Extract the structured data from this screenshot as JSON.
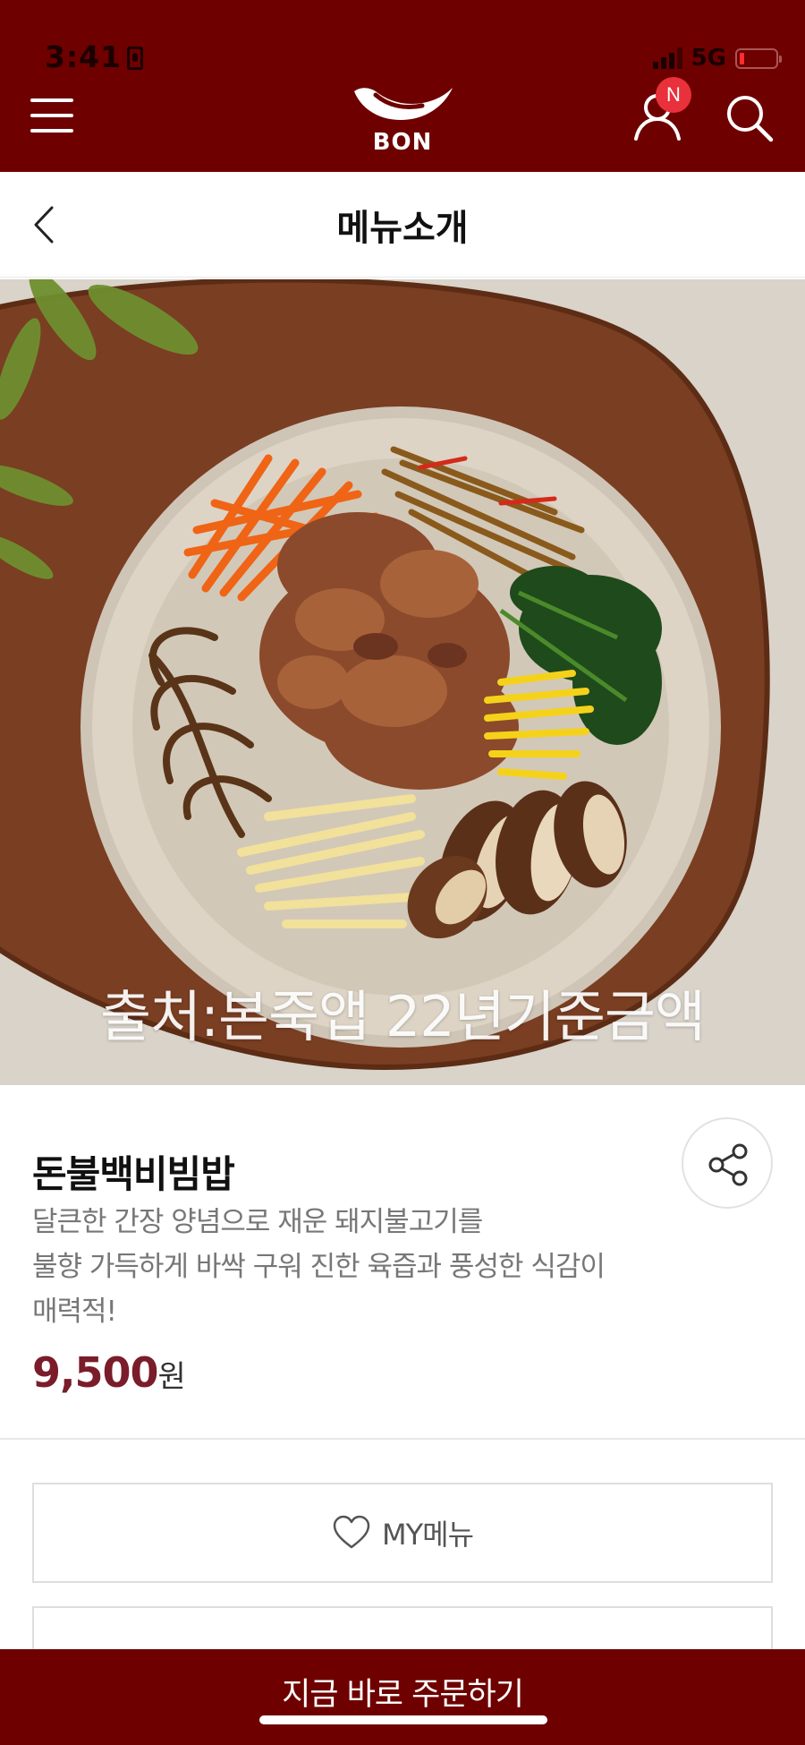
{
  "status_bar": {
    "time": "3:41",
    "network": "5G"
  },
  "brand": {
    "logo_text": "BON",
    "primary_color": "#6e0000",
    "badge_color": "#e8313b"
  },
  "header": {
    "notification_badge": "N"
  },
  "subheader": {
    "title": "메뉴소개"
  },
  "hero": {
    "caption": "출처:본죽앱 22년기준금액"
  },
  "product": {
    "name": "돈불백비빔밥",
    "description_lines": [
      "달큰한 간장 양념으로 재운 돼지불고기를",
      "불향 가득하게 바싹 구워 진한 육즙과 풍성한 식감이",
      "매력적!"
    ],
    "price": "9,500",
    "currency": "원",
    "price_color": "#7a1c2a"
  },
  "actions": {
    "my_menu_label": "MY메뉴",
    "order_label": "지금 바로 주문하기"
  }
}
